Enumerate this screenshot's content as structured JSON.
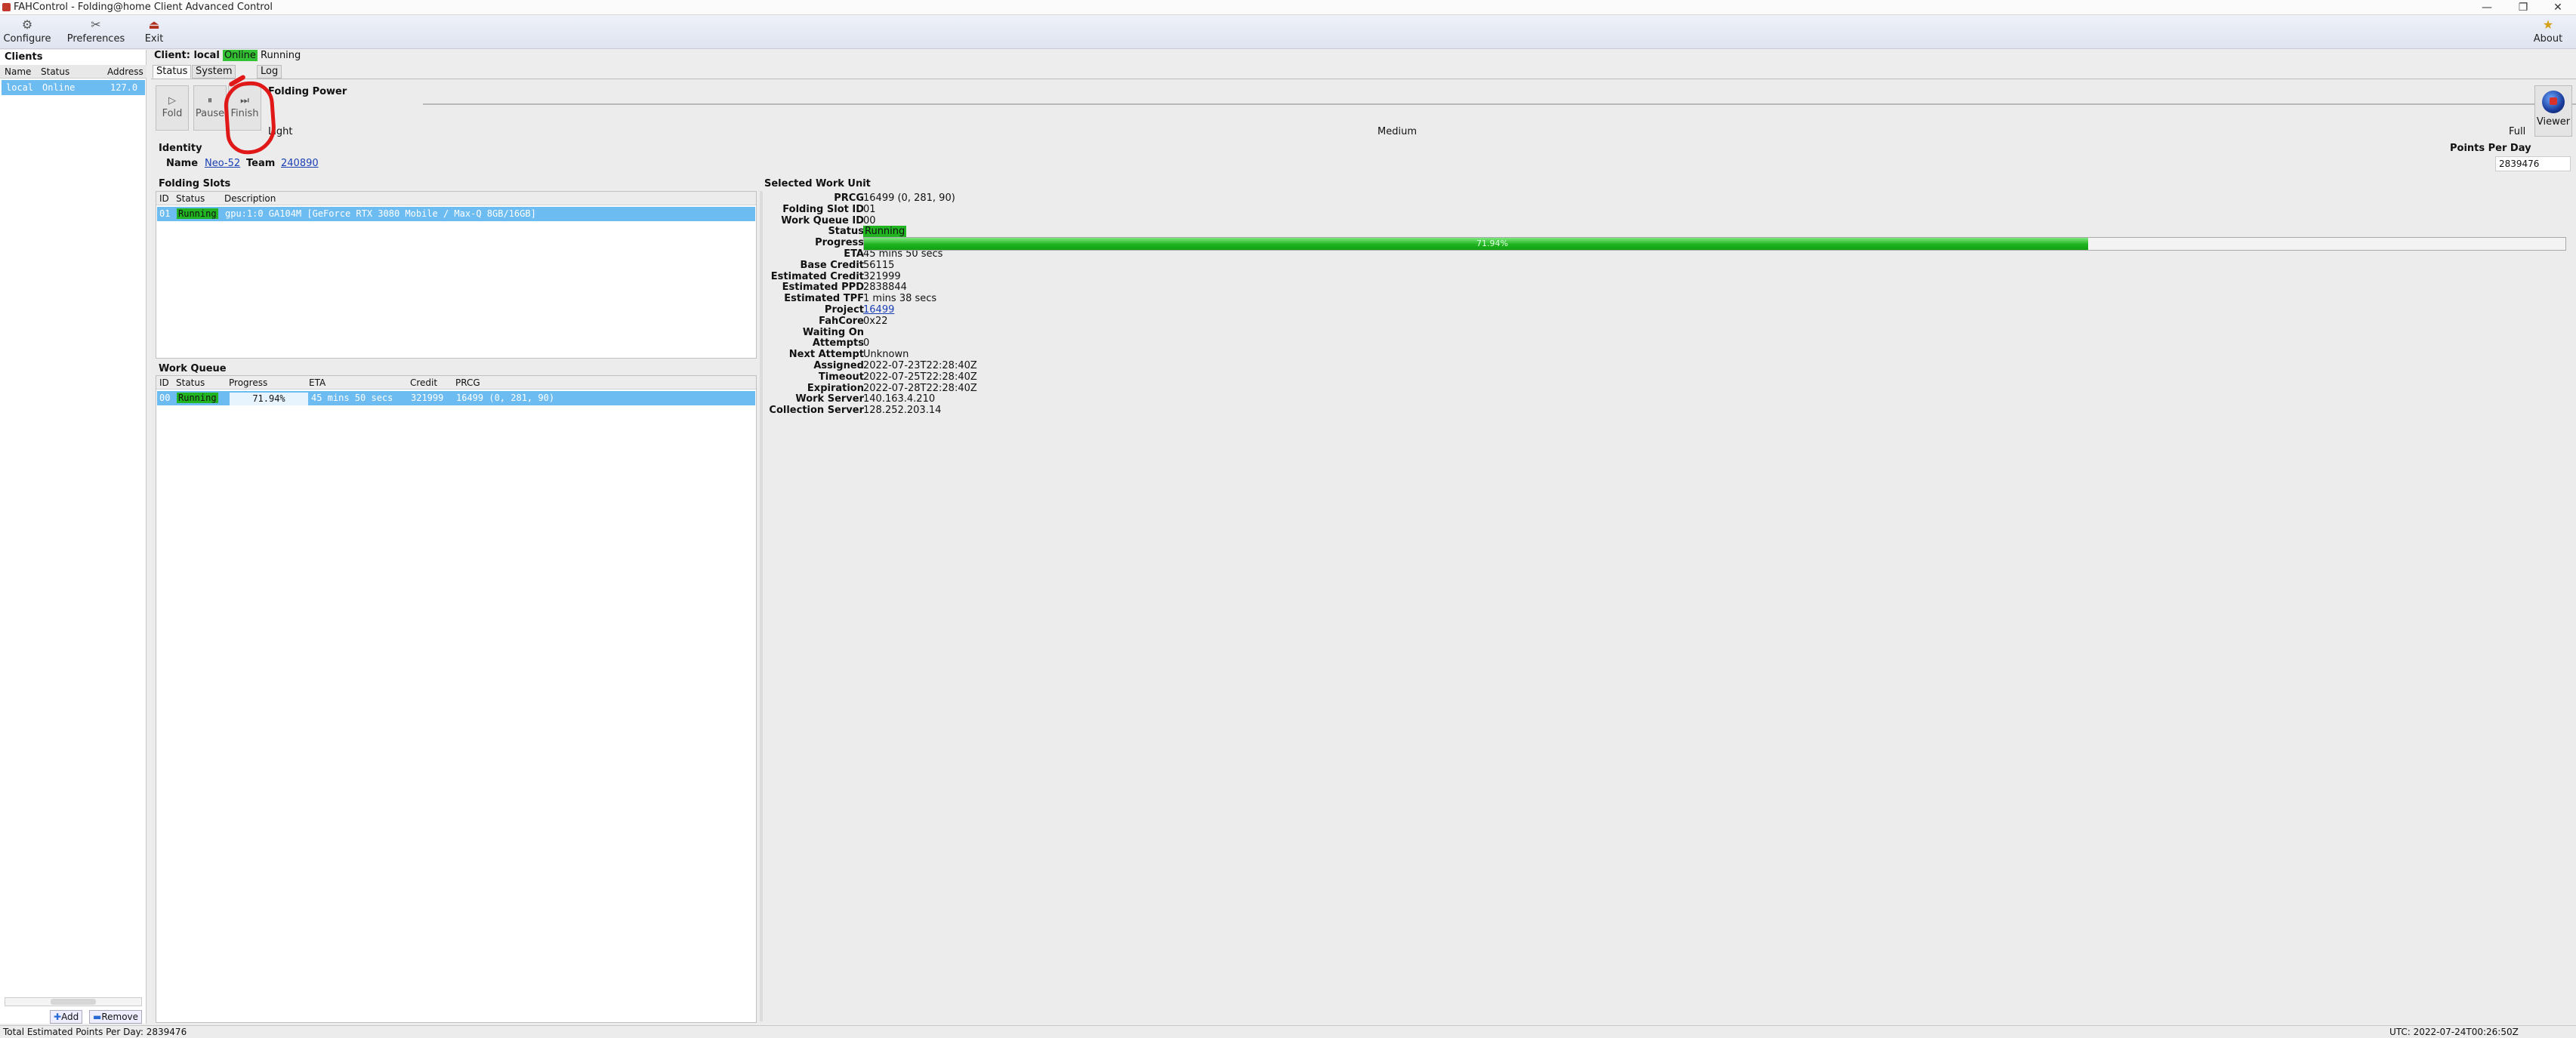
{
  "window": {
    "title": "FAHControl - Folding@home Client Advanced Control"
  },
  "toolbar": {
    "configure": "Configure",
    "preferences": "Preferences",
    "exit": "Exit",
    "about": "About"
  },
  "clients": {
    "title": "Clients",
    "columns": [
      "Name",
      "Status",
      "Address"
    ],
    "rows": [
      {
        "name": "local",
        "status": "Online",
        "address": "127.0"
      }
    ],
    "add": "Add",
    "remove": "Remove"
  },
  "client_header": {
    "prefix": "Client: local",
    "online": "Online",
    "running": "Running"
  },
  "tabs": [
    "Status",
    "System Info",
    "Log"
  ],
  "folding_power": {
    "title": "Folding Power",
    "fold": "Fold",
    "pause": "Pause",
    "finish": "Finish",
    "light": "Light",
    "medium": "Medium",
    "full": "Full",
    "viewer": "Viewer"
  },
  "identity": {
    "title": "Identity",
    "name_label": "Name",
    "name": "Neo-52",
    "team_label": "Team",
    "team": "240890"
  },
  "ppd": {
    "label": "Points Per Day",
    "value": "2839476"
  },
  "folding_slots": {
    "title": "Folding Slots",
    "columns": [
      "ID",
      "Status",
      "Description"
    ],
    "rows": [
      {
        "id": "01",
        "status": "Running",
        "description": "gpu:1:0 GA104M [GeForce RTX 3080 Mobile / Max-Q 8GB/16GB]"
      }
    ]
  },
  "work_queue": {
    "title": "Work Queue",
    "columns": [
      "ID",
      "Status",
      "Progress",
      "ETA",
      "Credit",
      "PRCG"
    ],
    "rows": [
      {
        "id": "00",
        "status": "Running",
        "progress": "71.94%",
        "eta": "45 mins 50 secs",
        "credit": "321999",
        "prcg": "16499 (0, 281, 90)"
      }
    ]
  },
  "work_unit": {
    "title": "Selected Work Unit",
    "progress_fraction": 0.7194,
    "progress_text": "71.94%",
    "fields": [
      {
        "label": "PRCG",
        "value": "16499 (0, 281, 90)"
      },
      {
        "label": "Folding Slot ID",
        "value": "01"
      },
      {
        "label": "Work Queue ID",
        "value": "00"
      },
      {
        "label": "Status",
        "value": "Running"
      },
      {
        "label": "Progress",
        "value": ""
      },
      {
        "label": "ETA",
        "value": "45 mins 50 secs"
      },
      {
        "label": "Base Credit",
        "value": "56115"
      },
      {
        "label": "Estimated Credit",
        "value": "321999"
      },
      {
        "label": "Estimated PPD",
        "value": "2838844"
      },
      {
        "label": "Estimated TPF",
        "value": "1 mins 38 secs"
      },
      {
        "label": "Project",
        "value": "16499"
      },
      {
        "label": "FahCore",
        "value": "0x22"
      },
      {
        "label": "Waiting On",
        "value": ""
      },
      {
        "label": "Attempts",
        "value": "0"
      },
      {
        "label": "Next Attempt",
        "value": "Unknown"
      },
      {
        "label": "Assigned",
        "value": "2022-07-23T22:28:40Z"
      },
      {
        "label": "Timeout",
        "value": "2022-07-25T22:28:40Z"
      },
      {
        "label": "Expiration",
        "value": "2022-07-28T22:28:40Z"
      },
      {
        "label": "Work Server",
        "value": "140.163.4.210"
      },
      {
        "label": "Collection Server",
        "value": "128.252.203.14"
      }
    ]
  },
  "statusbar": {
    "left": "Total Estimated Points Per Day: 2839476",
    "right": "UTC: 2022-07-24T00:26:50Z"
  },
  "colors": {
    "selection": "#6cbbf1",
    "running_green": "#22b522",
    "annotation_red": "#e01818",
    "link": "#1a3fb5"
  }
}
